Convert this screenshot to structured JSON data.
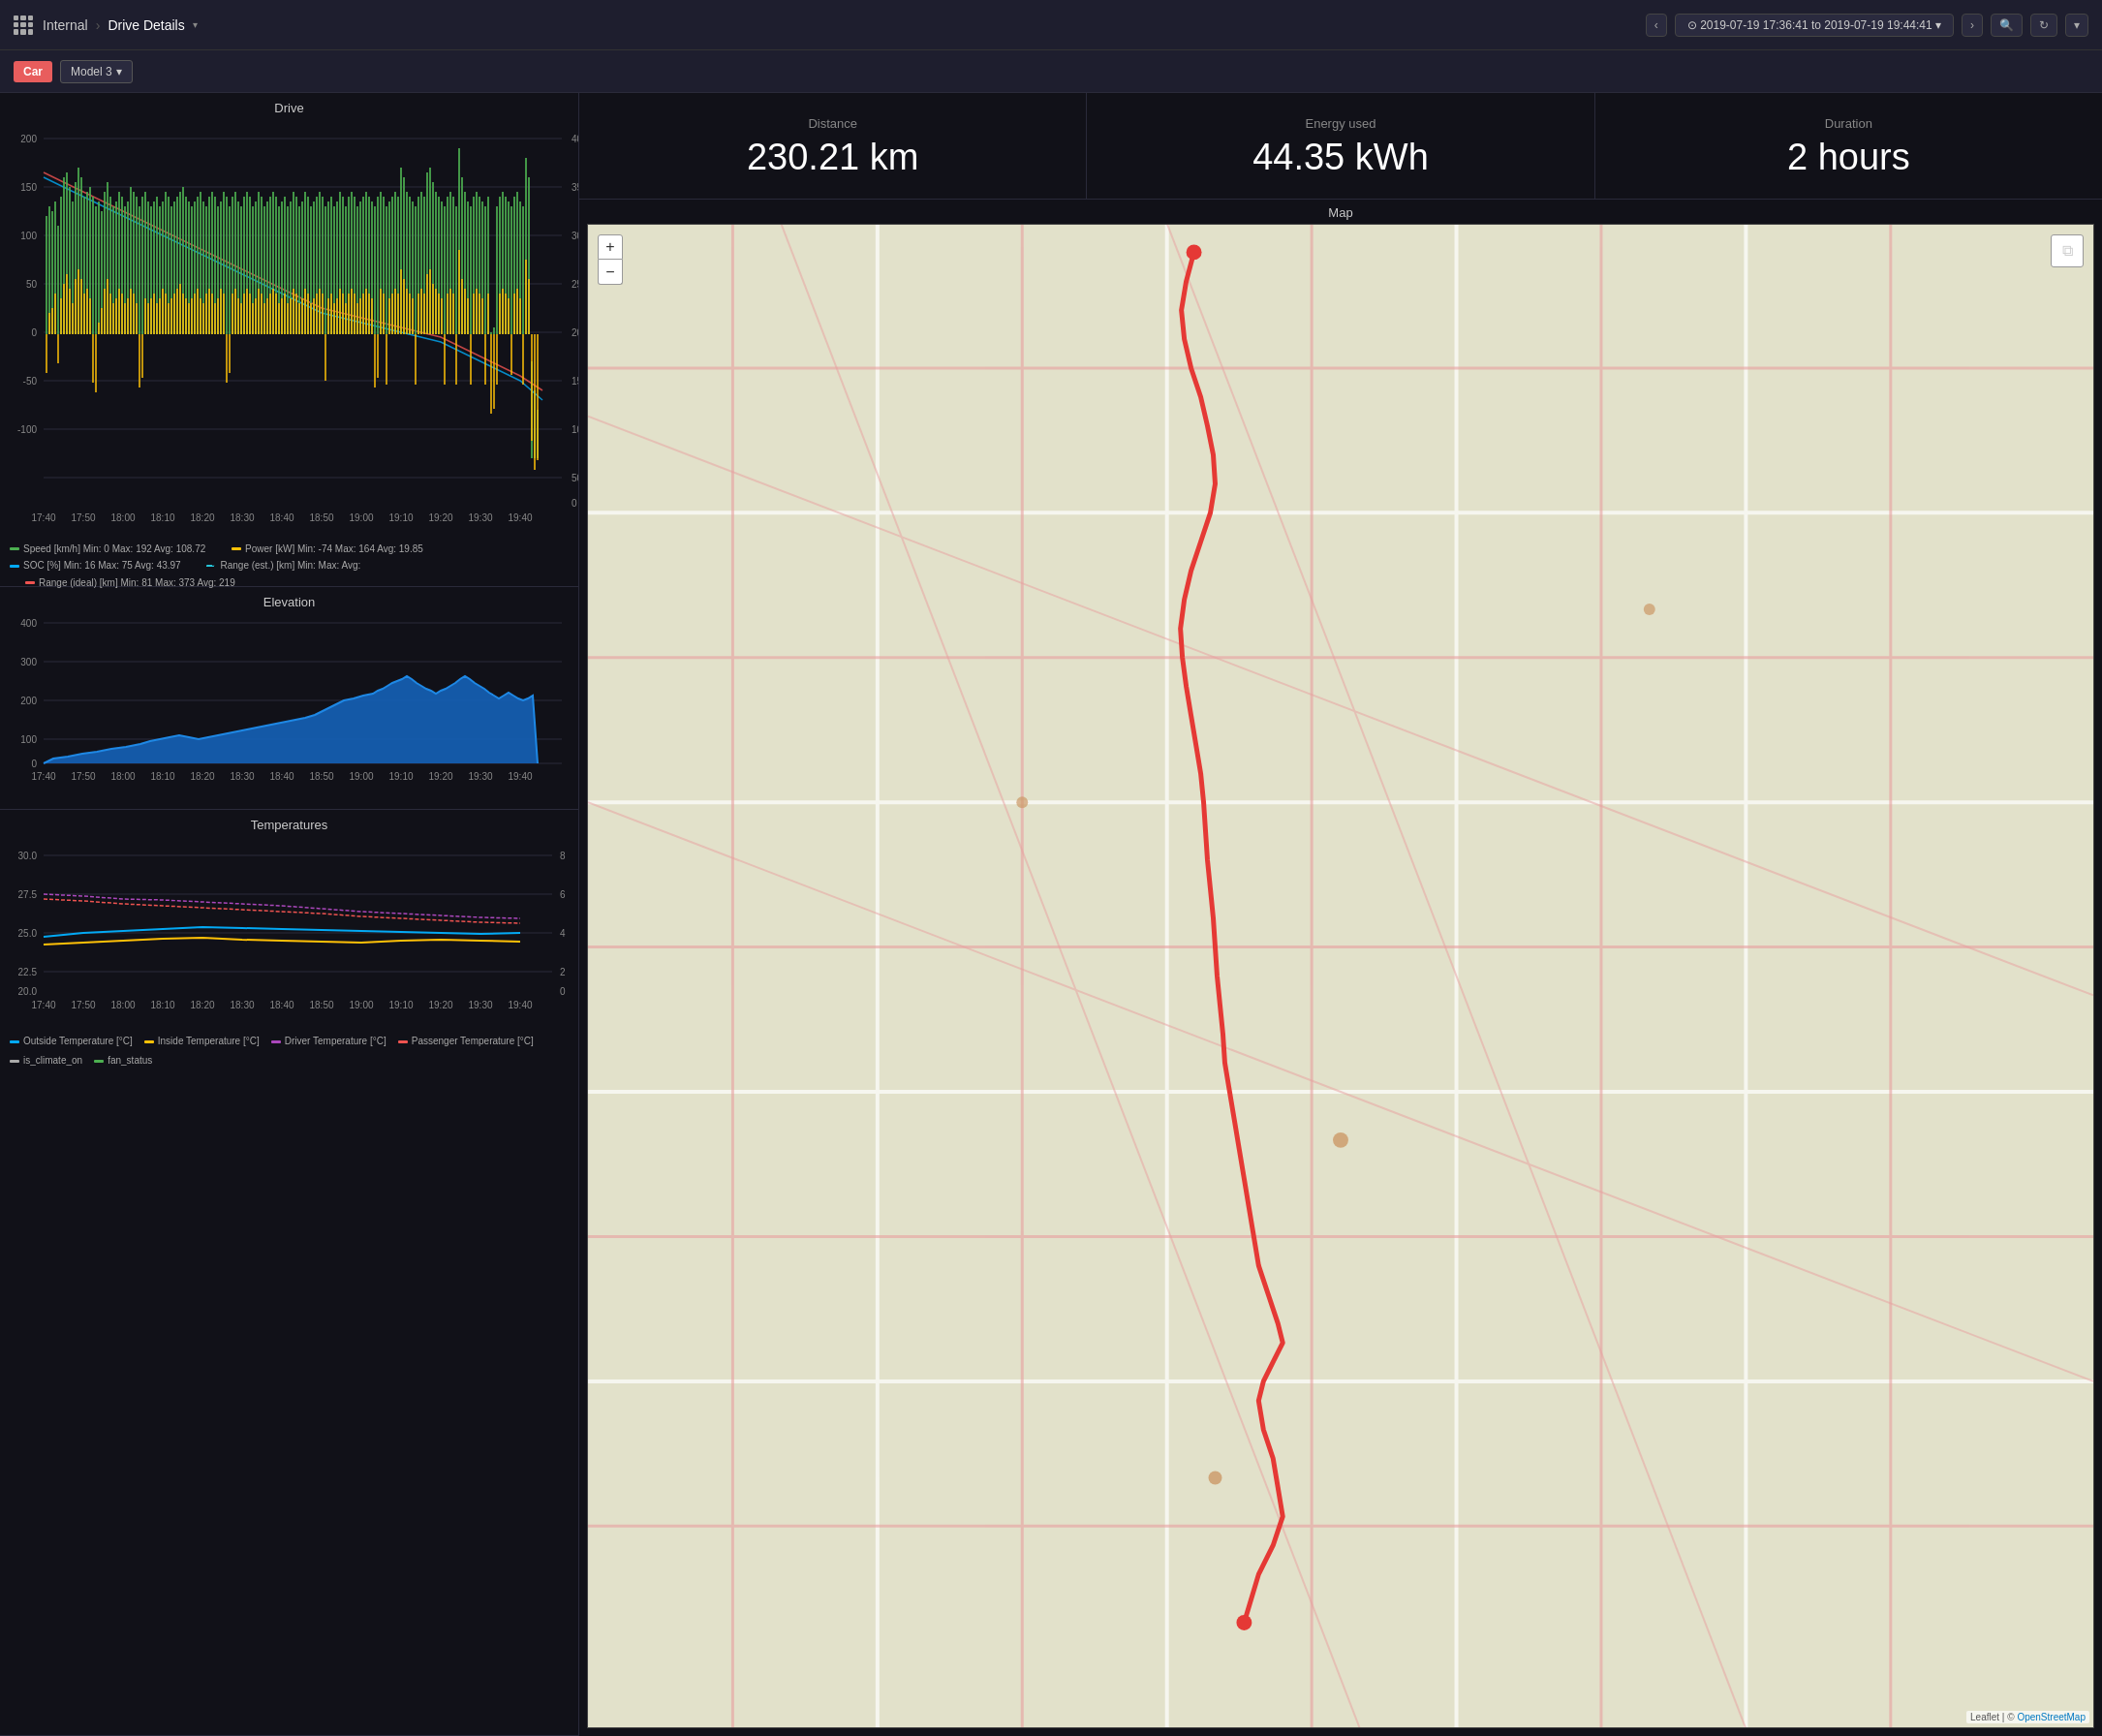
{
  "app": {
    "logo": "grid-icon",
    "breadcrumb_home": "Internal",
    "breadcrumb_sep": "›",
    "breadcrumb_current": "Drive Details",
    "breadcrumb_arrow": "▾"
  },
  "topbar": {
    "datetime_range": "⊙ 2019-07-19 17:36:41 to 2019-07-19 19:44:41 ▾",
    "nav_prev": "‹",
    "nav_next": "›",
    "search_icon": "🔍",
    "refresh_icon": "↻",
    "more_icon": "▾"
  },
  "subbar": {
    "car_tag": "Car",
    "model_label": "Model 3",
    "model_arrow": "▾"
  },
  "stats": {
    "distance_label": "Distance",
    "distance_value": "230.21 km",
    "energy_label": "Energy used",
    "energy_value": "44.35 kWh",
    "duration_label": "Duration",
    "duration_value": "2 hours"
  },
  "charts": {
    "drive_title": "Drive",
    "elevation_title": "Elevation",
    "temp_title": "Temperatures"
  },
  "drive_legend": {
    "speed_label": "Speed [km/h]  Min: 0  Max: 192  Avg: 108.72",
    "power_label": "Power [kW]  Min: -74  Max: 164  Avg: 19.85",
    "soc_label": "SOC [%]  Min: 16  Max: 75  Avg: 43.97",
    "range_est_label": "Range (est.) [km]  Min:    Max:    Avg:",
    "range_ideal_label": "Range (ideal) [km]  Min: 81  Max: 373  Avg: 219"
  },
  "temp_legend": {
    "outside_label": "Outside Temperature [°C]",
    "inside_label": "Inside Temperature [°C]",
    "driver_label": "Driver Temperature [°C]",
    "passenger_label": "Passenger Temperature [°C]",
    "climate_label": "is_climate_on",
    "fan_label": "fan_status"
  },
  "map": {
    "title": "Map",
    "zoom_in": "+",
    "zoom_out": "−",
    "attribution": "Leaflet | © OpenStreetMap"
  },
  "time_labels": [
    "17:40",
    "17:50",
    "18:00",
    "18:10",
    "18:20",
    "18:30",
    "18:40",
    "18:50",
    "19:00",
    "19:10",
    "19:20",
    "19:30",
    "19:40"
  ],
  "colors": {
    "speed": "#4caf50",
    "power": "#ffc107",
    "soc": "#03a9f4",
    "range_ideal": "#ef5350",
    "range_est": "#26c6da",
    "outside_temp": "#03a9f4",
    "inside_temp": "#ffc107",
    "driver_temp": "#ab47bc",
    "passenger_temp": "#ef5350",
    "elevation": "#1565c0",
    "elevation_fill": "#1565c0",
    "route": "#e53935"
  }
}
